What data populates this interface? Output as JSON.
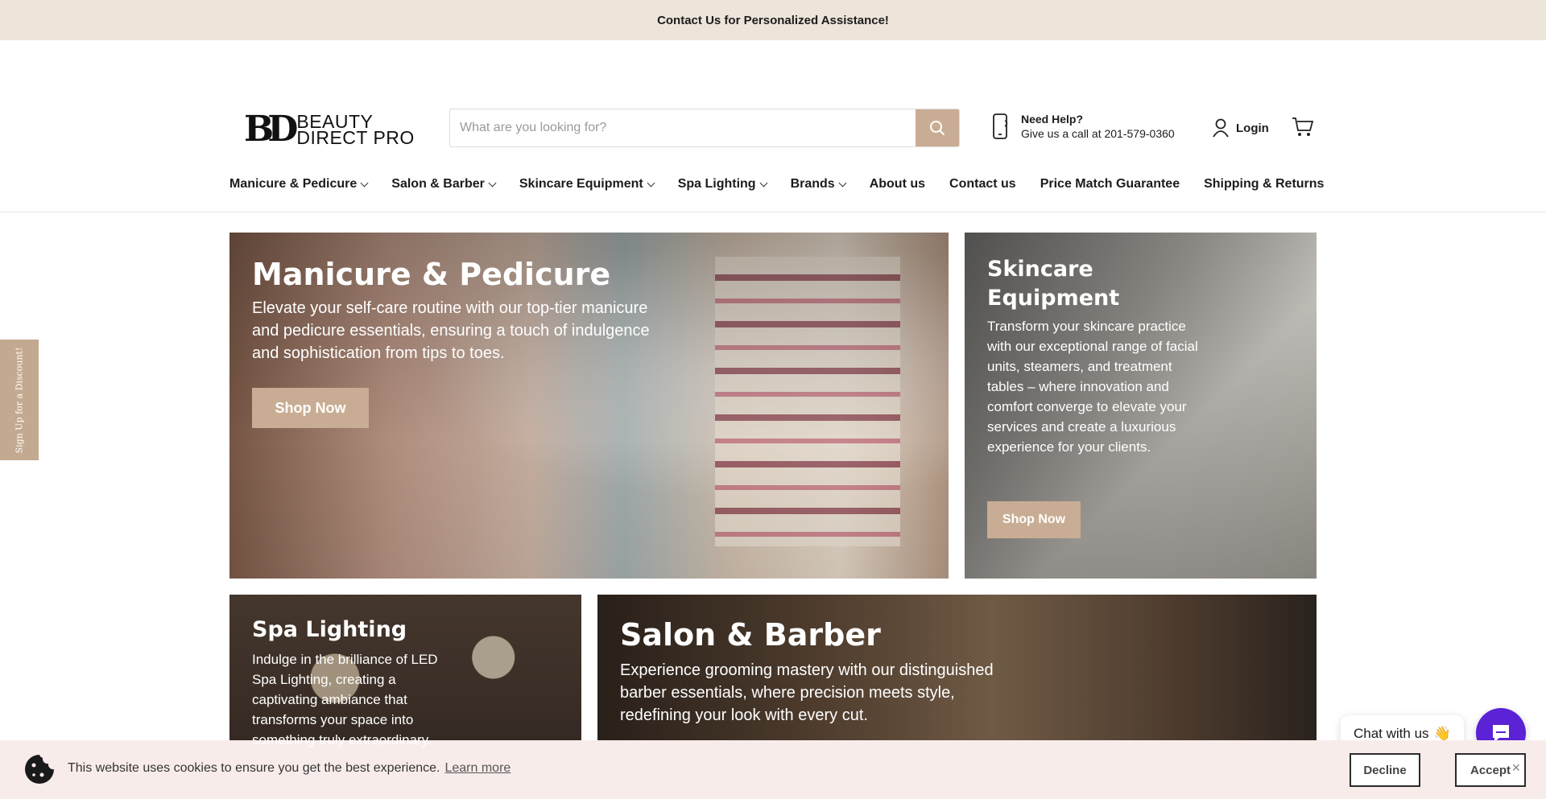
{
  "announcement": "Contact Us for Personalized Assistance!",
  "logo": {
    "mark": "BD",
    "line1": "BEAUTY",
    "line2": "DIRECT PRO"
  },
  "search": {
    "placeholder": "What are you looking for?",
    "value": ""
  },
  "help": {
    "title": "Need Help?",
    "subtitle": "Give us a call at 201-579-0360"
  },
  "account": {
    "login_label": "Login"
  },
  "nav": {
    "items": [
      {
        "label": "Manicure & Pedicure",
        "dropdown": true
      },
      {
        "label": "Salon & Barber",
        "dropdown": true
      },
      {
        "label": "Skincare Equipment",
        "dropdown": true
      },
      {
        "label": "Spa Lighting",
        "dropdown": true
      },
      {
        "label": "Brands",
        "dropdown": true
      },
      {
        "label": "About us",
        "dropdown": false
      },
      {
        "label": "Contact us",
        "dropdown": false
      },
      {
        "label": "Price Match Guarantee",
        "dropdown": false
      },
      {
        "label": "Shipping & Returns",
        "dropdown": false
      }
    ]
  },
  "tiles": {
    "manicure": {
      "title": "Manicure & Pedicure",
      "text": "Elevate your self-care routine with our top-tier manicure and pedicure essentials, ensuring a touch of indulgence and sophistication from tips to toes.",
      "button": "Shop Now"
    },
    "skincare": {
      "title": "Skincare Equipment",
      "text": "Transform your skincare practice with our exceptional range of facial units, steamers, and treatment tables – where innovation and comfort converge to elevate your services and create a luxurious experience for your clients.",
      "button": "Shop Now"
    },
    "spa": {
      "title": "Spa Lighting",
      "text": "Indulge in the brilliance of LED Spa Lighting, creating a captivating ambiance that transforms your space into something truly extraordinary."
    },
    "salon": {
      "title": "Salon & Barber",
      "text": "Experience grooming mastery with our distinguished barber essentials, where precision meets style, redefining your look with every cut."
    }
  },
  "discount_tab": "Sign Up for a Discount!",
  "chat": {
    "label": "Chat with us",
    "emoji": "👋"
  },
  "cookie": {
    "text": "This website uses cookies to ensure you get the best experience.",
    "learn_more": "Learn more",
    "decline": "Decline",
    "accept": "Accept",
    "close": "✕"
  },
  "colors": {
    "accent": "#c8ad94",
    "announce_bg": "#ede4da",
    "chat": "#5b22d6",
    "cookie_bg": "#f8eceb"
  }
}
